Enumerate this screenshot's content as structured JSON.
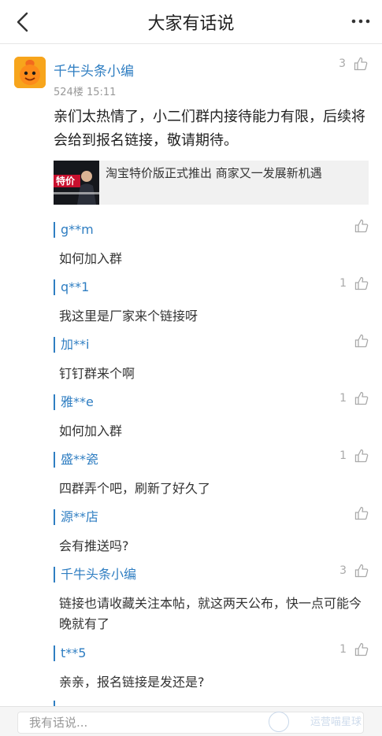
{
  "header": {
    "title": "大家有话说",
    "back_icon": "back-chevron-icon",
    "more_icon": "more-dots-icon"
  },
  "post": {
    "author": "千牛头条小编",
    "meta": "524楼 15:11",
    "likes": "3",
    "content": "亲们太热情了，小二们群内接待能力有限，后续将会给到报名链接，敬请期待。",
    "share": {
      "text": "淘宝特价版正式推出 商家又一发展新机遇",
      "thumb_caption": "特价"
    }
  },
  "replies": [
    {
      "name": "g**m",
      "likes": "",
      "text": "如何加入群"
    },
    {
      "name": "q**1",
      "likes": "1",
      "text": "我这里是厂家来个链接呀"
    },
    {
      "name": "加**i",
      "likes": "",
      "text": "钉钉群来个啊"
    },
    {
      "name": "雅**e",
      "likes": "1",
      "text": "如何加入群"
    },
    {
      "name": "盛**瓷",
      "likes": "1",
      "text": "四群弄个吧，刷新了好久了"
    },
    {
      "name": "源**店",
      "likes": "",
      "text": "会有推送吗?"
    },
    {
      "name": "千牛头条小编",
      "likes": "3",
      "text": "链接也请收藏关注本帖，就这两天公布，快一点可能今晚就有了"
    },
    {
      "name": "t**5",
      "likes": "1",
      "text": "亲亲，报名链接是发还是?"
    }
  ],
  "composer": {
    "placeholder": "我有话说...",
    "watermark": "运营喵星球"
  },
  "colors": {
    "accent": "#2f7ec2",
    "avatar_bg": "#f7a51c"
  }
}
